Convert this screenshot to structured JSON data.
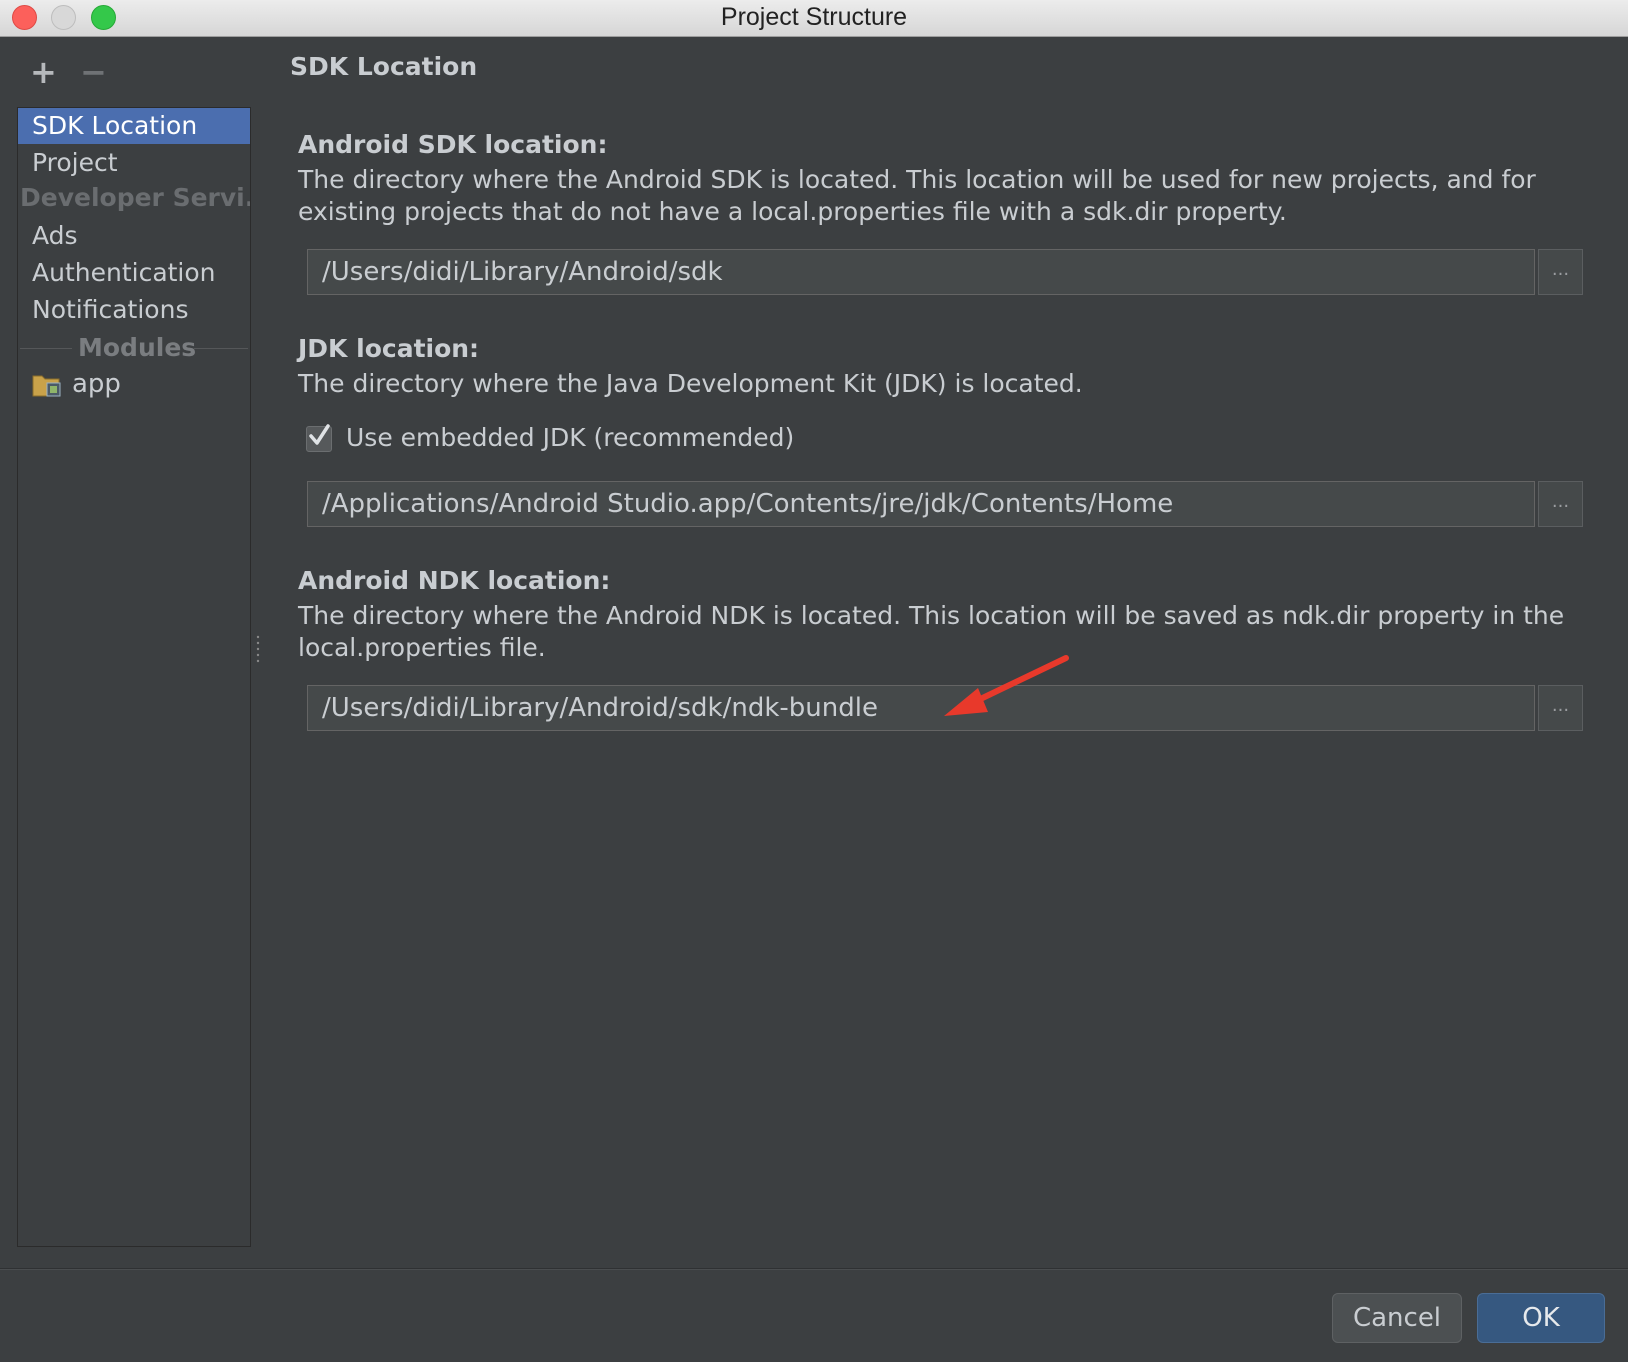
{
  "window": {
    "title": "Project Structure"
  },
  "toolbar": {
    "add": "+",
    "remove": "−"
  },
  "sidebar": {
    "items": [
      {
        "label": "SDK Location",
        "selected": true
      },
      {
        "label": "Project"
      }
    ],
    "developer_header": "Developer Servi...",
    "developer_items": [
      {
        "label": "Ads"
      },
      {
        "label": "Authentication"
      },
      {
        "label": "Notifications"
      }
    ],
    "modules_header": "Modules",
    "modules": [
      {
        "label": "app",
        "icon": "module-folder-icon"
      }
    ]
  },
  "content": {
    "section_title": "SDK Location",
    "sdk": {
      "label": "Android SDK location:",
      "description": "The directory where the Android SDK is located. This location will be used for new projects, and for existing projects that do not have a local.properties file with a sdk.dir property.",
      "path": "/Users/didi/Library/Android/sdk",
      "browse": "..."
    },
    "jdk": {
      "label": "JDK location:",
      "description": "The directory where the Java Development Kit (JDK) is located.",
      "use_embedded_label": "Use embedded JDK (recommended)",
      "use_embedded_checked": true,
      "path": "/Applications/Android Studio.app/Contents/jre/jdk/Contents/Home",
      "browse": "..."
    },
    "ndk": {
      "label": "Android NDK location:",
      "description": "The directory where the Android NDK is located. This location will be saved as ndk.dir property in the local.properties file.",
      "path": "/Users/didi/Library/Android/sdk/ndk-bundle",
      "browse": "..."
    }
  },
  "footer": {
    "cancel": "Cancel",
    "ok": "OK"
  },
  "colors": {
    "background": "#3c3f41",
    "selection": "#4b6eaf",
    "annotation_arrow": "#e8392b",
    "ok_button": "#365880"
  }
}
